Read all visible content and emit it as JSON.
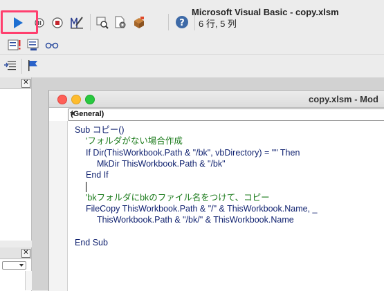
{
  "window_title": "Microsoft Visual Basic - copy.xlsm",
  "cursor_position": "6 行, 5 列",
  "toolbar": {
    "row1": [
      "run-icon",
      "break-icon",
      "reset-icon",
      "design-mode-icon",
      "project-explorer-icon",
      "properties-icon",
      "toolbox-icon",
      "help-icon"
    ],
    "row2": [
      "immediate-window-icon",
      "locals-window-icon",
      "watch-window-icon"
    ],
    "row3": [
      "step-icon",
      "flag-icon"
    ]
  },
  "code_window": {
    "title": "copy.xlsm - Mod",
    "object_combo": "(General)",
    "lines": [
      {
        "text": "Sub コピー()",
        "type": "kw",
        "indent": 0
      },
      {
        "text": "'フォルダがない場合作成",
        "type": "cm",
        "indent": 1
      },
      {
        "text": "If Dir(ThisWorkbook.Path & \"/bk\", vbDirectory) = \"\" Then",
        "type": "kw",
        "indent": 1
      },
      {
        "text": "MkDir ThisWorkbook.Path & \"/bk\"",
        "type": "kw",
        "indent": 2
      },
      {
        "text": "End If",
        "type": "kw",
        "indent": 1
      },
      {
        "text": "",
        "type": "kw",
        "indent": 1
      },
      {
        "text": "'bkフォルダにbkのファイル名をつけて、コピー",
        "type": "cm",
        "indent": 1
      },
      {
        "text": "FileCopy ThisWorkbook.Path & \"/\" & ThisWorkbook.Name, _",
        "type": "kw",
        "indent": 1
      },
      {
        "text": "ThisWorkbook.Path & \"/bk/\" & ThisWorkbook.Name",
        "type": "kw",
        "indent": 2
      },
      {
        "text": "",
        "type": "kw",
        "indent": 0
      },
      {
        "text": "End Sub",
        "type": "kw",
        "indent": 0
      }
    ]
  },
  "panel_close_label": "✕",
  "colors": {
    "highlight": "#ff3f6e",
    "code_text": "#0d1f6e",
    "comment_text": "#1a7a1a",
    "close_dot": "#fe5f57",
    "minimize_dot": "#febc2e",
    "zoom_dot": "#28c840"
  }
}
